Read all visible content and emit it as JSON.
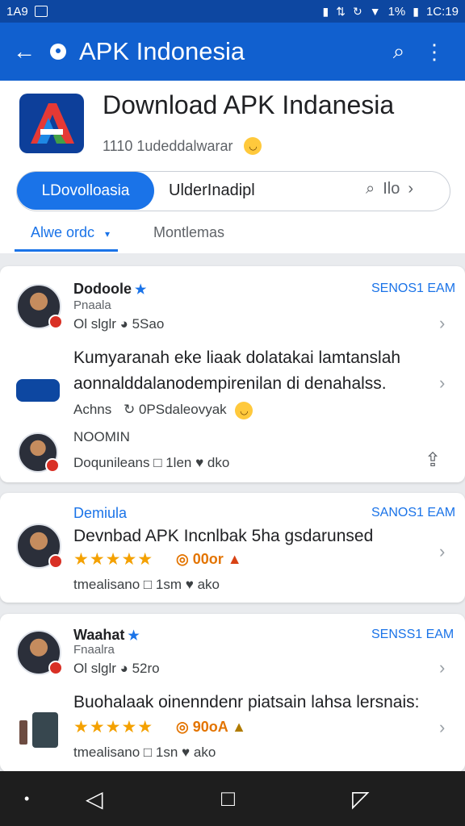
{
  "status_bar": {
    "time": "1A9",
    "battery_text": "1%",
    "clock_right": "1C:19"
  },
  "app_bar": {
    "title": "APK Indonesia"
  },
  "app_header": {
    "title": "Download APK Indanesia",
    "subtitle": "1110 1udeddalwarar",
    "segment_active": "LDovolloasia",
    "segment_second": "UlderInadipl",
    "segment_search_text": "Ilo",
    "subtab_active": "Alwe ordc",
    "subtab_second": "Montlemas"
  },
  "cards": [
    {
      "name": "Dodoole",
      "subtitle": "Pnaala",
      "meta": "Ol slglr  ◕ 5Sao",
      "link": "SENOS1 EAM",
      "body_line1": "Kumyaranah eke liaak dolatakai lamtanslah",
      "body_line2": "aonnalddalanodempirenilan di denahalss.",
      "author": "Achns",
      "author_meta": "0PSdaleovyak",
      "second_name": "NOOMIN",
      "second_meta": "Doqunileans   □ 1len   ♥ dko"
    },
    {
      "name": "Demiula",
      "link": "SANOS1 EAM",
      "body": "Devnbad APK Incnlbak 5ha gsdarunsed",
      "rating_text": "00or",
      "meta": "tmealisano   □ 1sm   ♥ ako"
    },
    {
      "name": "Waahat",
      "subtitle": "Fnaalra",
      "meta": "Ol slglr  ◕ 52ro",
      "link": "SENSS1 EAM",
      "body": "Buohalaak oinenndenr piatsain lahsa lersnais:",
      "rating_text": "90oA",
      "meta2": "tmealisano   □ 1sn   ♥ ako"
    }
  ]
}
